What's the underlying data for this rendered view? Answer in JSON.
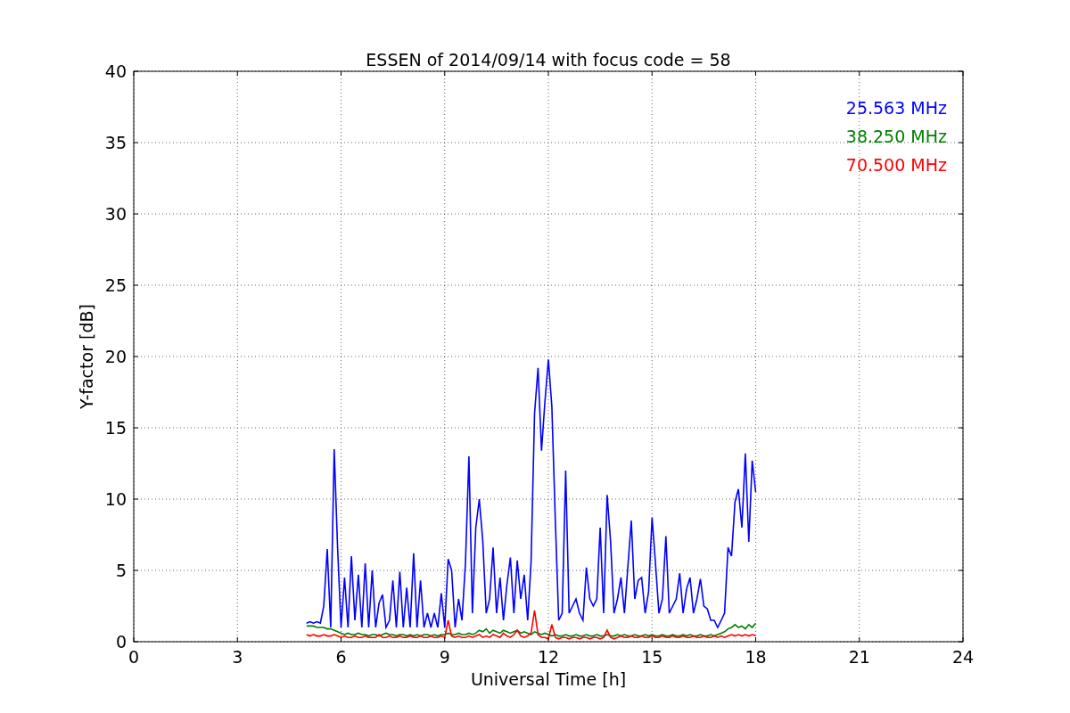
{
  "chart": {
    "chart_data": {
      "type": "line",
      "grid": true,
      "title": "ESSEN of 2014/09/14 with focus code = 58",
      "xlabel": "Universal Time [h]",
      "ylabel": "Y-factor [dB]",
      "xlim": [
        0,
        24
      ],
      "ylim": [
        0,
        40
      ],
      "xticks": [
        0,
        3,
        6,
        9,
        12,
        15,
        18,
        21,
        24
      ],
      "yticks": [
        0,
        5,
        10,
        15,
        20,
        25,
        30,
        35,
        40
      ],
      "x": [
        5.0,
        5.1,
        5.2,
        5.3,
        5.4,
        5.5,
        5.6,
        5.7,
        5.8,
        5.9,
        6.0,
        6.1,
        6.2,
        6.3,
        6.4,
        6.5,
        6.6,
        6.7,
        6.8,
        6.9,
        7.0,
        7.1,
        7.2,
        7.3,
        7.4,
        7.5,
        7.6,
        7.7,
        7.8,
        7.9,
        8.0,
        8.1,
        8.2,
        8.3,
        8.4,
        8.5,
        8.6,
        8.7,
        8.8,
        8.9,
        9.0,
        9.1,
        9.2,
        9.3,
        9.4,
        9.5,
        9.6,
        9.7,
        9.8,
        9.9,
        10.0,
        10.1,
        10.2,
        10.3,
        10.4,
        10.5,
        10.6,
        10.7,
        10.8,
        10.9,
        11.0,
        11.1,
        11.2,
        11.3,
        11.4,
        11.5,
        11.6,
        11.7,
        11.8,
        11.9,
        12.0,
        12.1,
        12.2,
        12.3,
        12.4,
        12.5,
        12.6,
        12.7,
        12.8,
        12.9,
        13.0,
        13.1,
        13.2,
        13.3,
        13.4,
        13.5,
        13.6,
        13.7,
        13.8,
        13.9,
        14.0,
        14.1,
        14.2,
        14.3,
        14.4,
        14.5,
        14.6,
        14.7,
        14.8,
        14.9,
        15.0,
        15.1,
        15.2,
        15.3,
        15.4,
        15.5,
        15.6,
        15.7,
        15.8,
        15.9,
        16.0,
        16.1,
        16.2,
        16.3,
        16.4,
        16.5,
        16.6,
        16.7,
        16.8,
        16.9,
        17.0,
        17.1,
        17.2,
        17.3,
        17.4,
        17.5,
        17.6,
        17.7,
        17.8,
        17.9,
        18.0
      ],
      "series": [
        {
          "name": "25.563 MHz",
          "color": "#0000ff",
          "values": [
            1.3,
            1.4,
            1.3,
            1.4,
            1.3,
            2.5,
            6.5,
            1,
            13.5,
            6.6,
            1,
            4.5,
            1,
            6,
            1.5,
            4.7,
            1,
            5.5,
            1,
            5,
            1,
            2.7,
            3.3,
            1,
            1.5,
            4.3,
            1,
            4.9,
            1,
            3.8,
            1,
            6.2,
            1,
            4.3,
            1,
            2,
            1,
            2,
            1,
            3.4,
            1,
            5.8,
            5,
            1,
            3,
            1.5,
            5.5,
            13,
            2,
            8,
            10,
            7.1,
            2,
            3,
            6.6,
            2,
            4.5,
            1.5,
            4,
            5.9,
            2,
            5.7,
            3,
            4.7,
            1.5,
            5.6,
            16,
            19.2,
            13.4,
            16.8,
            19.8,
            16.5,
            8.5,
            1.5,
            2,
            12,
            2,
            2.5,
            3,
            2,
            1.5,
            5.2,
            3,
            2.5,
            3,
            8,
            2,
            10.3,
            7,
            2,
            3,
            4.5,
            2,
            5.2,
            8.5,
            3,
            4.3,
            4.5,
            2,
            3.5,
            8.7,
            5.5,
            2,
            3,
            7.4,
            2,
            2.5,
            3,
            4.8,
            2,
            3.7,
            4.5,
            2,
            3,
            4.4,
            2.5,
            2.3,
            1.5,
            1.5,
            1,
            1.5,
            2,
            6.6,
            6,
            9.8,
            10.7,
            8,
            13.2,
            7,
            12.7,
            10.5
          ]
        },
        {
          "name": "38.250 MHz",
          "color": "#008000",
          "values": [
            1.1,
            1.1,
            1.1,
            1.0,
            1.0,
            1.0,
            0.9,
            0.9,
            0.8,
            0.7,
            0.6,
            0.5,
            0.6,
            0.5,
            0.5,
            0.6,
            0.5,
            0.5,
            0.4,
            0.5,
            0.5,
            0.4,
            0.5,
            0.6,
            0.5,
            0.5,
            0.4,
            0.5,
            0.5,
            0.4,
            0.5,
            0.4,
            0.5,
            0.4,
            0.5,
            0.5,
            0.4,
            0.5,
            0.4,
            0.5,
            0.5,
            0.6,
            0.5,
            0.5,
            0.6,
            0.5,
            0.5,
            0.6,
            0.5,
            0.6,
            0.8,
            0.7,
            0.9,
            0.6,
            0.8,
            0.7,
            0.6,
            0.8,
            0.7,
            0.6,
            0.7,
            0.8,
            0.6,
            0.7,
            0.6,
            0.5,
            0.7,
            0.6,
            0.5,
            0.6,
            0.5,
            0.4,
            0.5,
            0.4,
            0.4,
            0.5,
            0.4,
            0.4,
            0.5,
            0.4,
            0.4,
            0.5,
            0.4,
            0.4,
            0.5,
            0.4,
            0.4,
            0.5,
            0.4,
            0.4,
            0.5,
            0.4,
            0.5,
            0.4,
            0.4,
            0.5,
            0.4,
            0.4,
            0.5,
            0.4,
            0.5,
            0.4,
            0.4,
            0.5,
            0.4,
            0.4,
            0.5,
            0.4,
            0.4,
            0.5,
            0.4,
            0.5,
            0.4,
            0.4,
            0.5,
            0.4,
            0.4,
            0.5,
            0.4,
            0.5,
            0.6,
            0.7,
            0.9,
            1.0,
            1.2,
            1.0,
            1.1,
            0.9,
            1.2,
            1.0,
            1.3
          ]
        },
        {
          "name": "70.500 MHz",
          "color": "#ff0000",
          "values": [
            0.5,
            0.4,
            0.5,
            0.4,
            0.4,
            0.5,
            0.4,
            0.4,
            0.5,
            0.4,
            0.3,
            0.4,
            0.3,
            0.3,
            0.4,
            0.3,
            0.3,
            0.4,
            0.3,
            0.3,
            0.3,
            0.5,
            0.3,
            0.3,
            0.4,
            0.3,
            0.3,
            0.4,
            0.3,
            0.3,
            0.4,
            0.3,
            0.3,
            0.4,
            0.3,
            0.3,
            0.4,
            0.3,
            0.3,
            0.4,
            0.3,
            1.5,
            0.4,
            0.3,
            0.4,
            0.3,
            0.3,
            0.4,
            0.3,
            0.4,
            0.5,
            0.3,
            0.4,
            0.3,
            0.5,
            0.4,
            0.3,
            0.6,
            0.4,
            0.3,
            0.5,
            0.8,
            0.4,
            0.3,
            0.4,
            0.6,
            2.2,
            0.5,
            0.3,
            0.3,
            0.2,
            1.2,
            0.3,
            0.2,
            0.3,
            0.3,
            0.2,
            0.3,
            0.3,
            0.2,
            0.3,
            0.3,
            0.2,
            0.3,
            0.3,
            0.2,
            0.3,
            0.8,
            0.3,
            0.2,
            0.3,
            0.4,
            0.3,
            0.3,
            0.4,
            0.3,
            0.3,
            0.4,
            0.3,
            0.3,
            0.4,
            0.3,
            0.3,
            0.4,
            0.3,
            0.3,
            0.4,
            0.3,
            0.3,
            0.4,
            0.3,
            0.3,
            0.4,
            0.3,
            0.3,
            0.4,
            0.3,
            0.3,
            0.4,
            0.3,
            0.4,
            0.3,
            0.4,
            0.5,
            0.4,
            0.5,
            0.4,
            0.5,
            0.4,
            0.5,
            0.4
          ]
        }
      ]
    }
  }
}
